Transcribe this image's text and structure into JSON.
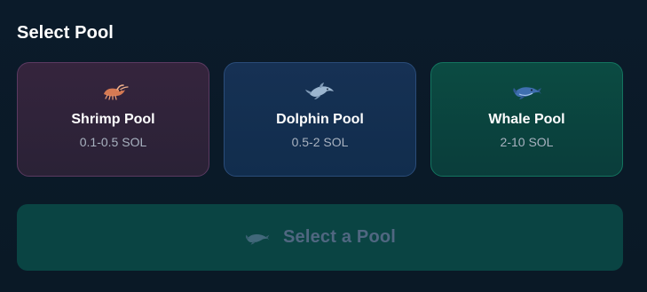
{
  "page": {
    "heading": "Select Pool"
  },
  "pools": [
    {
      "name": "Shrimp Pool",
      "range": "0.1-0.5 SOL",
      "icon": "shrimp-icon",
      "accent": "#5b3a61"
    },
    {
      "name": "Dolphin Pool",
      "range": "0.5-2 SOL",
      "icon": "dolphin-icon",
      "accent": "#2a4c79"
    },
    {
      "name": "Whale Pool",
      "range": "2-10 SOL",
      "icon": "whale-icon",
      "accent": "#13745f"
    }
  ],
  "action": {
    "button_label": "Select a Pool",
    "button_icon": "whale-icon",
    "disabled_color": "#506781"
  }
}
